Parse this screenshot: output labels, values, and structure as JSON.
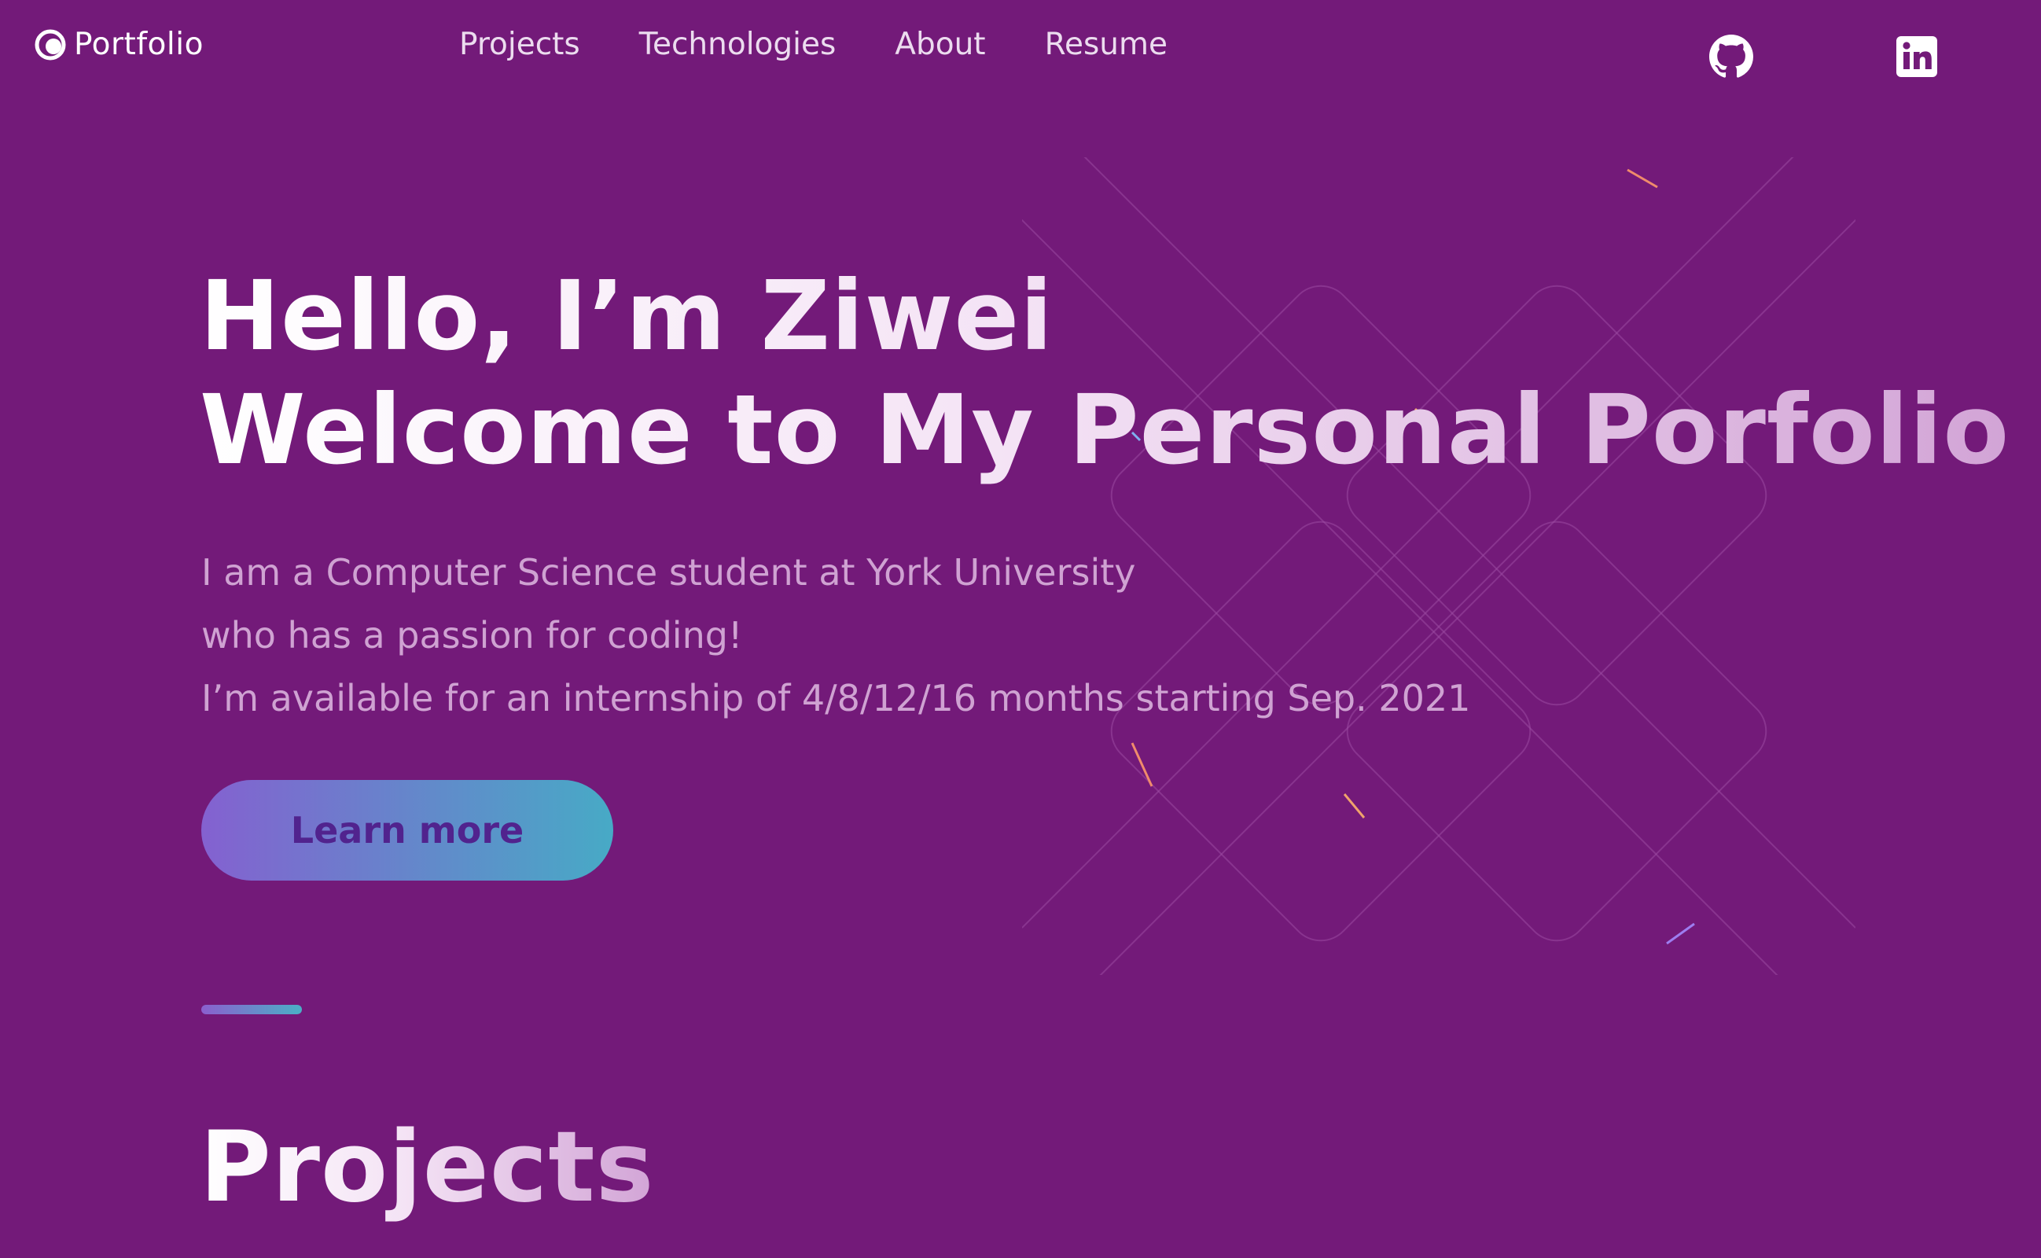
{
  "header": {
    "logo_text": "Portfolio",
    "nav": [
      "Projects",
      "Technologies",
      "About",
      "Resume"
    ],
    "social": [
      {
        "name": "github",
        "icon": "github-icon"
      },
      {
        "name": "linkedin",
        "icon": "linkedin-icon"
      }
    ]
  },
  "hero": {
    "title_line1": "Hello, I’m Ziwei",
    "title_line2": "Welcome to My Personal Porfolio",
    "description": [
      "I am a Computer Science student at York University",
      "who has a passion for coding!",
      "I’m available for an internship of 4/8/12/16 months starting Sep. 2021"
    ],
    "cta_label": "Learn more"
  },
  "projects": {
    "heading": "Projects"
  },
  "colors": {
    "background": "#731a79",
    "muted_text": "#cfa2d2",
    "nav_text": "#ecdcef",
    "accent_gradient_start": "#8461d0",
    "accent_gradient_end": "#47aac6",
    "button_text": "#51238e"
  }
}
